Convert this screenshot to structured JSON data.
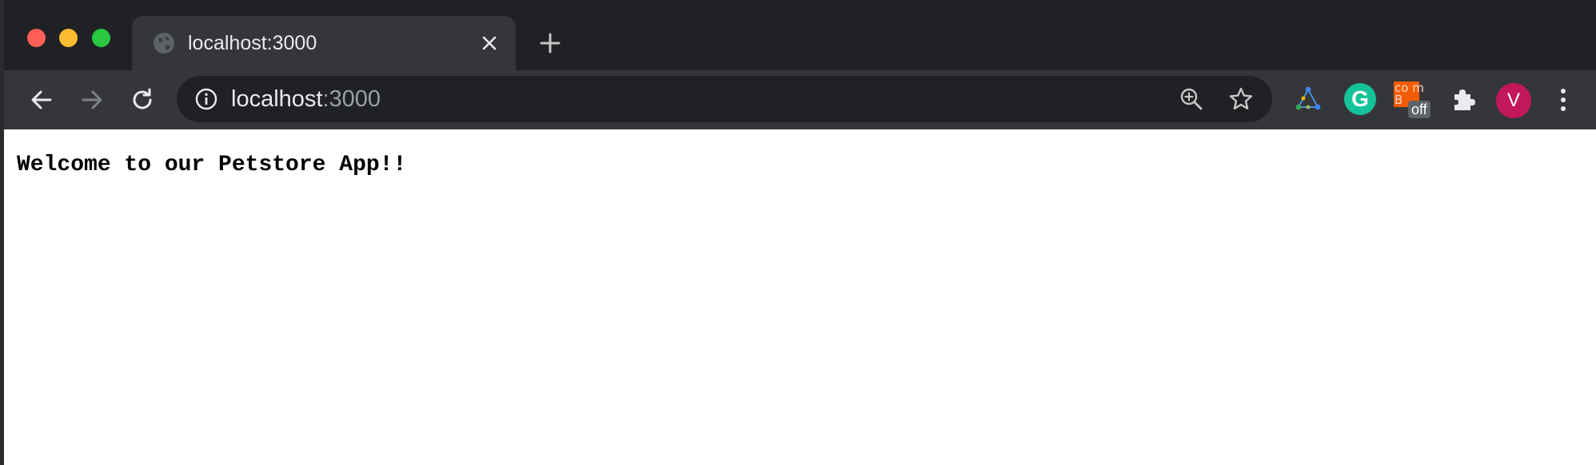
{
  "tab": {
    "title": "localhost:3000",
    "favicon_icon": "globe-icon",
    "close_icon": "close-icon"
  },
  "new_tab_icon": "plus-icon",
  "toolbar": {
    "back_icon": "arrow-left-icon",
    "forward_icon": "arrow-right-icon",
    "reload_icon": "reload-icon"
  },
  "omnibox": {
    "host": "localhost",
    "port": ":3000",
    "info_icon": "info-icon",
    "zoom_icon": "zoom-in-icon",
    "bookmark_icon": "star-icon"
  },
  "extensions": {
    "grammarly_letter": "G",
    "combo_glyph": "co m B",
    "combo_badge": "off"
  },
  "profile": {
    "initial": "V",
    "color": "#c2185b"
  },
  "page": {
    "welcome_text": "Welcome to our Petstore App!!"
  }
}
